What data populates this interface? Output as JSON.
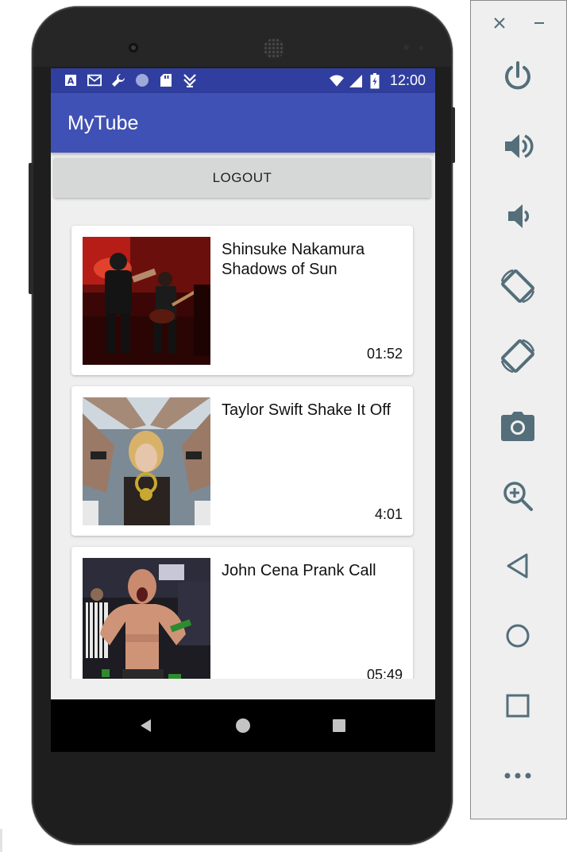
{
  "status_bar": {
    "time": "12:00",
    "icons": [
      "a-icon",
      "mail-icon",
      "wrench-icon",
      "circle-icon",
      "sdcard-icon",
      "download-done-icon",
      "wifi-icon",
      "signal-icon",
      "battery-icon"
    ]
  },
  "app": {
    "title": "MyTube",
    "logout_label": "LOGOUT"
  },
  "videos": [
    {
      "title": "Shinsuke Nakamura Shadows of Sun",
      "duration": "01:52"
    },
    {
      "title": "Taylor Swift Shake It Off",
      "duration": "4:01"
    },
    {
      "title": "John Cena Prank Call",
      "duration": "05:49"
    }
  ],
  "navigation": [
    "back-icon",
    "home-icon",
    "recents-icon"
  ],
  "emulator_panel": {
    "tools": [
      "close-icon",
      "minimize-icon",
      "power-icon",
      "volume-up-icon",
      "volume-down-icon",
      "rotate-left-icon",
      "rotate-right-icon",
      "camera-icon",
      "zoom-icon",
      "back-icon",
      "home-icon",
      "overview-icon",
      "more-icon"
    ]
  },
  "colors": {
    "status_bar": "#303f9f",
    "app_bar": "#3f51b5",
    "panel_icon": "#546e7a"
  }
}
